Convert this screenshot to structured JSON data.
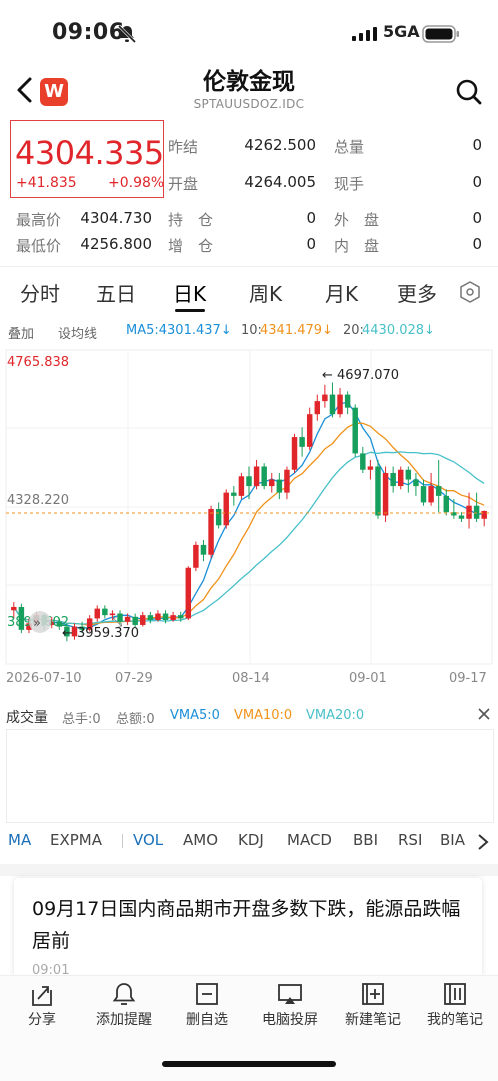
{
  "status": {
    "time": "09:06",
    "network": "5GA"
  },
  "header": {
    "logo_letter": "W",
    "title": "伦敦金现",
    "symbol": "SPTAUUSDOZ.IDC"
  },
  "quote": {
    "price": "4304.335",
    "change": "+41.835",
    "change_pct": "+0.98%",
    "prev_close_label": "昨结",
    "prev_close": "4262.500",
    "total_vol_label": "总量",
    "total_vol": "0",
    "open_label": "开盘",
    "open": "4264.005",
    "current_hand_label": "现手",
    "current_hand": "0",
    "high_label": "最高价",
    "high": "4304.730",
    "position_label": "持　仓",
    "position": "0",
    "outer_label": "外　盘",
    "outer": "0",
    "low_label": "最低价",
    "low": "4256.800",
    "increase_label": "增　仓",
    "increase": "0",
    "inner_label": "内　盘",
    "inner": "0"
  },
  "tabs": [
    "分时",
    "五日",
    "日K",
    "周K",
    "月K",
    "更多"
  ],
  "active_tab": "日K",
  "ma_bar": {
    "overlay": "叠加",
    "line_setting": "设均线",
    "ma5": "MA5:4301.437↓",
    "ma10_label": "10:",
    "ma10": "4341.479↓",
    "ma20_label": "20:",
    "ma20": "4430.028↓"
  },
  "chart_data": {
    "type": "candlestick",
    "y_max_label": "4765.838",
    "y_mid_label": "4328.220",
    "y_min_label": "3890.602",
    "high_marker": "4697.070",
    "low_marker": "3959.370",
    "x_labels": [
      "2026-07-10",
      "07-29",
      "08-14",
      "09-01",
      "09-17"
    ],
    "ylim": [
      3890.602,
      4765.838
    ],
    "candles": [
      [
        4000,
        4010,
        3975,
        4025
      ],
      [
        4010,
        3940,
        3930,
        4020
      ],
      [
        3940,
        3960,
        3930,
        3975
      ],
      [
        3960,
        3985,
        3950,
        3995
      ],
      [
        3985,
        3955,
        3940,
        3990
      ],
      [
        3955,
        3965,
        3945,
        3980
      ],
      [
        3965,
        3950,
        3940,
        3975
      ],
      [
        3950,
        3920,
        3905,
        3960
      ],
      [
        3920,
        3950,
        3910,
        3960
      ],
      [
        3950,
        3940,
        3930,
        3965
      ],
      [
        3940,
        3975,
        3935,
        3985
      ],
      [
        3975,
        4005,
        3965,
        4015
      ],
      [
        4005,
        3985,
        3975,
        4015
      ],
      [
        3985,
        3990,
        3970,
        4000
      ],
      [
        3990,
        3965,
        3955,
        4000
      ],
      [
        3965,
        3980,
        3955,
        3990
      ],
      [
        3980,
        3955,
        3945,
        3990
      ],
      [
        3955,
        3985,
        3950,
        3995
      ],
      [
        3985,
        3970,
        3960,
        3995
      ],
      [
        3970,
        3990,
        3965,
        4000
      ],
      [
        3990,
        3970,
        3960,
        4000
      ],
      [
        3970,
        3985,
        3965,
        3995
      ],
      [
        3985,
        3975,
        3965,
        3995
      ],
      [
        3975,
        4130,
        3970,
        4135
      ],
      [
        4130,
        4200,
        4120,
        4210
      ],
      [
        4200,
        4170,
        4150,
        4215
      ],
      [
        4170,
        4310,
        4160,
        4320
      ],
      [
        4310,
        4260,
        4250,
        4330
      ],
      [
        4260,
        4360,
        4250,
        4370
      ],
      [
        4360,
        4350,
        4320,
        4380
      ],
      [
        4350,
        4410,
        4340,
        4420
      ],
      [
        4410,
        4380,
        4340,
        4440
      ],
      [
        4380,
        4440,
        4370,
        4460
      ],
      [
        4440,
        4380,
        4370,
        4450
      ],
      [
        4380,
        4400,
        4360,
        4420
      ],
      [
        4400,
        4360,
        4340,
        4420
      ],
      [
        4360,
        4430,
        4340,
        4440
      ],
      [
        4430,
        4530,
        4420,
        4540
      ],
      [
        4530,
        4500,
        4470,
        4560
      ],
      [
        4500,
        4600,
        4490,
        4620
      ],
      [
        4600,
        4640,
        4580,
        4660
      ],
      [
        4640,
        4660,
        4620,
        4690
      ],
      [
        4660,
        4600,
        4590,
        4697
      ],
      [
        4600,
        4660,
        4590,
        4680
      ],
      [
        4660,
        4620,
        4600,
        4670
      ],
      [
        4620,
        4480,
        4470,
        4630
      ],
      [
        4480,
        4430,
        4420,
        4500
      ],
      [
        4430,
        4440,
        4400,
        4460
      ],
      [
        4440,
        4290,
        4280,
        4460
      ],
      [
        4290,
        4420,
        4270,
        4440
      ],
      [
        4420,
        4380,
        4360,
        4440
      ],
      [
        4380,
        4430,
        4370,
        4440
      ],
      [
        4430,
        4400,
        4360,
        4440
      ],
      [
        4400,
        4380,
        4350,
        4420
      ],
      [
        4380,
        4330,
        4320,
        4400
      ],
      [
        4330,
        4380,
        4320,
        4420
      ],
      [
        4380,
        4350,
        4300,
        4460
      ],
      [
        4350,
        4300,
        4290,
        4370
      ],
      [
        4300,
        4290,
        4280,
        4340
      ],
      [
        4290,
        4280,
        4270,
        4300
      ],
      [
        4280,
        4320,
        4250,
        4360
      ],
      [
        4320,
        4280,
        4270,
        4360
      ],
      [
        4280,
        4304,
        4257,
        4305
      ]
    ]
  },
  "volume": {
    "title": "成交量",
    "total_hands": "总手:0",
    "total_amount": "总额:0",
    "vma5": "VMA5:0",
    "vma10": "VMA10:0",
    "vma20": "VMA20:0"
  },
  "indicators": [
    "MA",
    "EXPMA",
    "VOL",
    "AMO",
    "KDJ",
    "MACD",
    "BBI",
    "RSI",
    "BIA"
  ],
  "news": {
    "title": "09月17日国内商品期市开盘多数下跌，能源品跌幅居前",
    "time": "09:01"
  },
  "bottom_nav": [
    "分享",
    "添加提醒",
    "删自选",
    "电脑投屏",
    "新建笔记",
    "我的笔记"
  ],
  "colors": {
    "up": "#e0262a",
    "down": "#17a05d",
    "ma5": "#1a8fd8",
    "ma10": "#f0921b",
    "ma20": "#48c0c8"
  }
}
